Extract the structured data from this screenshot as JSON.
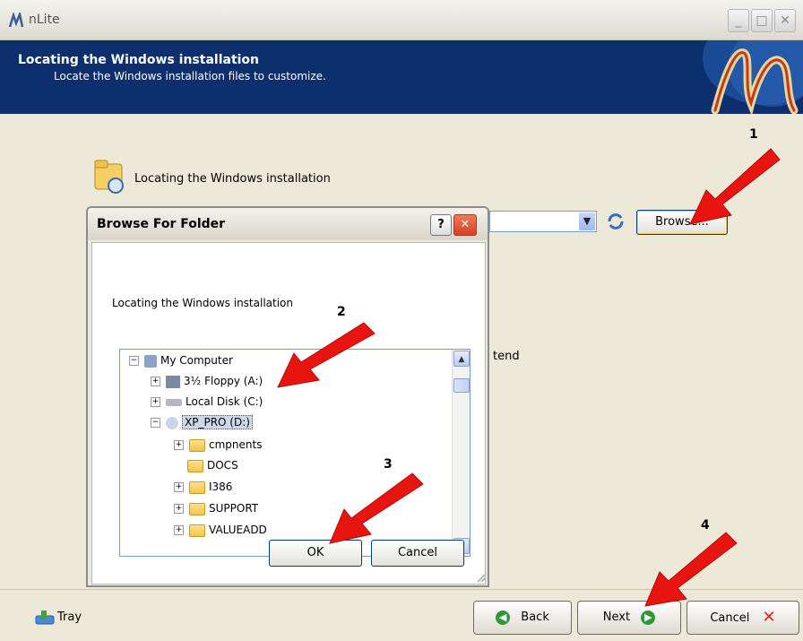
{
  "window": {
    "title": "nLite"
  },
  "header": {
    "title": "Locating the Windows installation",
    "subtitle": "Locate the Windows installation files to customize."
  },
  "main": {
    "section_label": "Locating the Windows installation",
    "browse_label": "Browse...",
    "extend_text": "tend"
  },
  "dialog": {
    "title": "Browse For Folder",
    "help_label": "?",
    "instruction": "Locating the Windows installation",
    "ok_label": "OK",
    "cancel_label": "Cancel",
    "tree": {
      "my_computer": "My Computer",
      "floppy": "3½ Floppy (A:)",
      "local_disk": "Local Disk (C:)",
      "xp_pro": "XP_PRO (D:)",
      "folders": [
        "cmpnents",
        "DOCS",
        "I386",
        "SUPPORT",
        "VALUEADD"
      ]
    }
  },
  "steps": [
    "1",
    "2",
    "3",
    "4"
  ],
  "footer": {
    "tray_label": "Tray",
    "back_label": "Back",
    "next_label": "Next",
    "cancel_label": "Cancel"
  },
  "colors": {
    "header_bg": "#0d2f6e",
    "arrow_red": "#e8140f",
    "body_bg": "#ece9d8"
  },
  "icons": [
    "nlite-logo-icon",
    "minimize-icon",
    "maximize-icon",
    "close-icon",
    "folder-search-icon",
    "refresh-icon",
    "computer-icon",
    "floppy-icon",
    "disk-icon",
    "cd-icon",
    "folder-icon",
    "tray-icon",
    "back-arrow-icon",
    "next-arrow-icon",
    "cancel-x-icon"
  ]
}
